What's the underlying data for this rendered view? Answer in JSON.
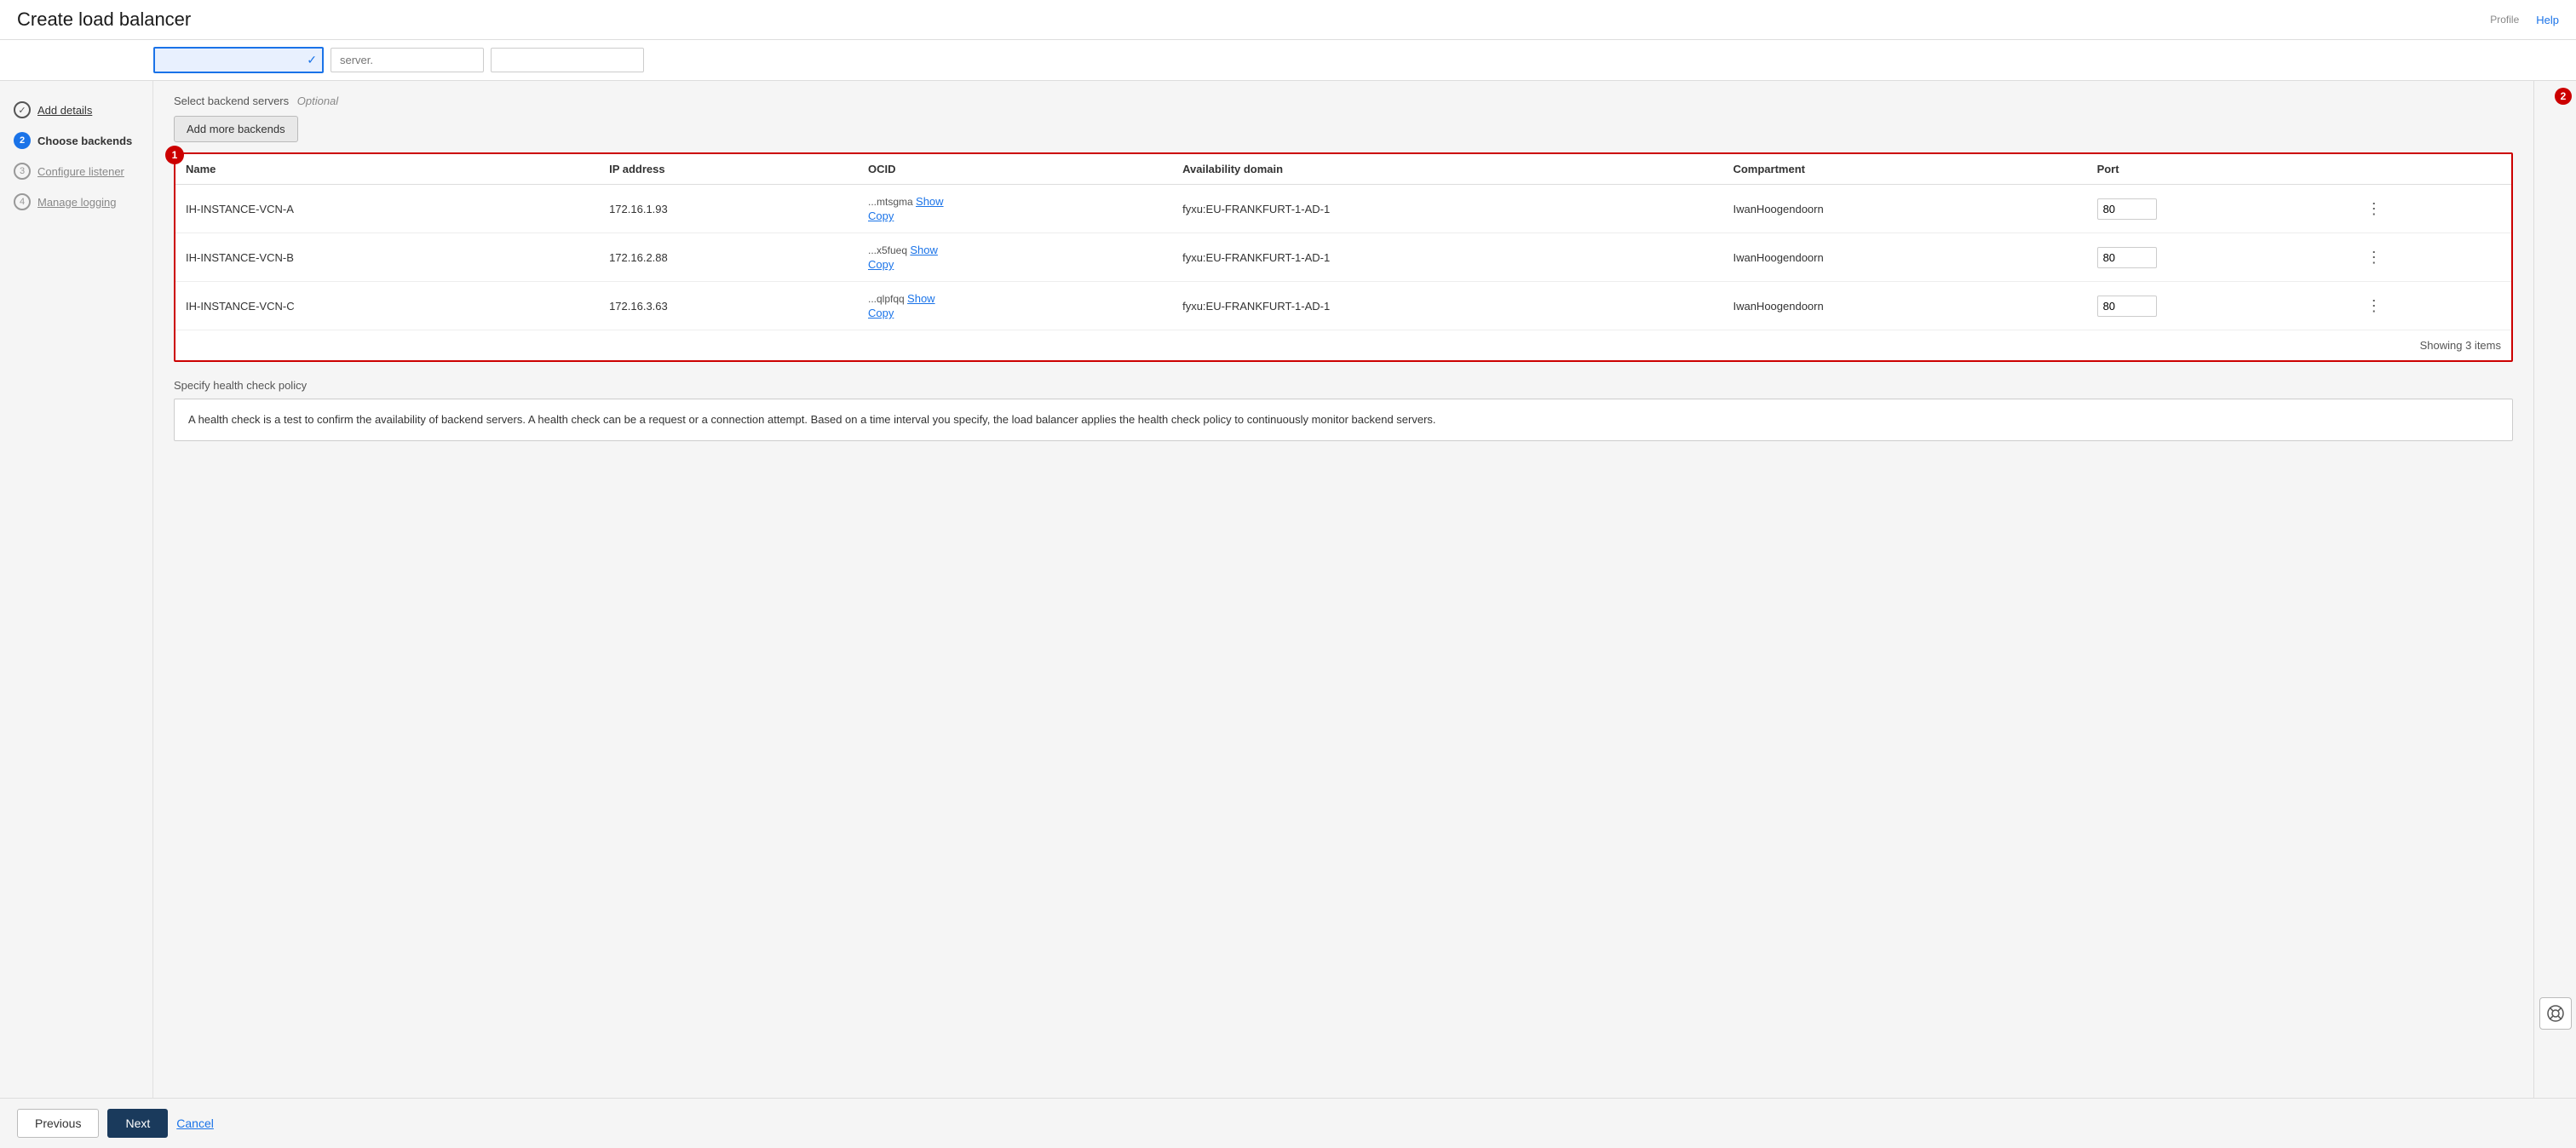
{
  "header": {
    "title": "Create load balancer",
    "help_label": "Help",
    "profile_label": "Profile"
  },
  "sidebar": {
    "items": [
      {
        "id": "add-details",
        "step": "1",
        "label": "Add details",
        "state": "done"
      },
      {
        "id": "choose-backends",
        "step": "2",
        "label": "Choose backends",
        "state": "active"
      },
      {
        "id": "configure-listener",
        "step": "3",
        "label": "Configure listener",
        "state": "inactive"
      },
      {
        "id": "manage-logging",
        "step": "4",
        "label": "Manage logging",
        "state": "inactive"
      }
    ]
  },
  "top_inputs": {
    "input1_value": "",
    "checkmark": "✓",
    "input2_placeholder": "server.",
    "input3_value": ""
  },
  "backends_section": {
    "label": "Select backend servers",
    "optional_label": "Optional",
    "add_button_label": "Add more backends",
    "step_badge": "1",
    "table": {
      "columns": [
        "Name",
        "IP address",
        "OCID",
        "Availability domain",
        "Compartment",
        "Port"
      ],
      "rows": [
        {
          "name": "IH-INSTANCE-VCN-A",
          "ip": "172.16.1.93",
          "ocid_short": "...mtsgma",
          "show_label": "Show",
          "copy_label": "Copy",
          "availability_domain": "fyxu:EU-FRANKFURT-1-AD-1",
          "compartment": "IwanHoogendoorn",
          "port": "80"
        },
        {
          "name": "IH-INSTANCE-VCN-B",
          "ip": "172.16.2.88",
          "ocid_short": "...x5fueq",
          "show_label": "Show",
          "copy_label": "Copy",
          "availability_domain": "fyxu:EU-FRANKFURT-1-AD-1",
          "compartment": "IwanHoogendoorn",
          "port": "80"
        },
        {
          "name": "IH-INSTANCE-VCN-C",
          "ip": "172.16.3.63",
          "ocid_short": "...qlpfqq",
          "show_label": "Show",
          "copy_label": "Copy",
          "availability_domain": "fyxu:EU-FRANKFURT-1-AD-1",
          "compartment": "IwanHoogendoorn",
          "port": "80"
        }
      ],
      "showing_text": "Showing 3 items"
    }
  },
  "health_check": {
    "label": "Specify health check policy",
    "description": "A health check is a test to confirm the availability of backend servers. A health check can be a request or a connection attempt. Based on a time interval you specify, the load balancer applies the health check policy to continuously monitor backend servers."
  },
  "footer": {
    "previous_label": "Previous",
    "next_label": "Next",
    "cancel_label": "Cancel"
  },
  "right_sidebar": {
    "badge": "2"
  }
}
